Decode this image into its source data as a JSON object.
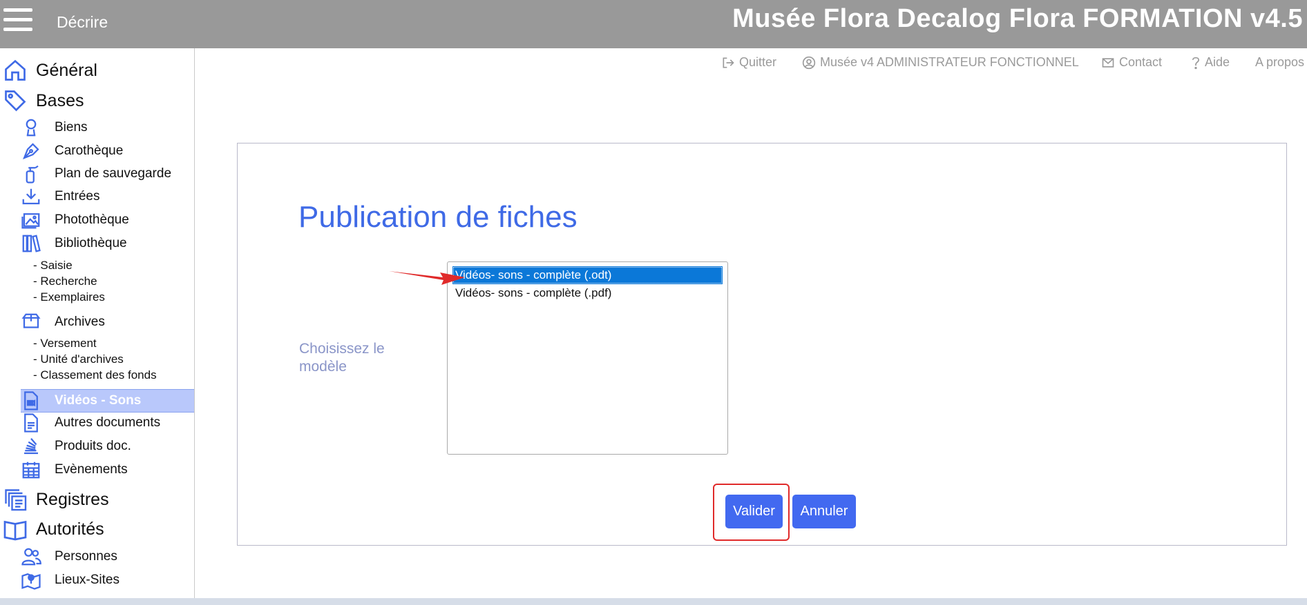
{
  "header": {
    "module": "Décrire",
    "title": "Musée Flora Decalog Flora FORMATION v4.5"
  },
  "toplinks": {
    "quit": "Quitter",
    "user": "Musée v4 ADMINISTRATEUR FONCTIONNEL",
    "contact": "Contact",
    "help": "Aide",
    "about": "A propos"
  },
  "sidebar": {
    "general": "Général",
    "bases": "Bases",
    "biens": "Biens",
    "carotheque": "Carothèque",
    "plan": "Plan de sauvegarde",
    "entrees": "Entrées",
    "phototheque": "Photothèque",
    "bibliotheque": "Bibliothèque",
    "biblio_subs": [
      "- Saisie",
      "- Recherche",
      "- Exemplaires"
    ],
    "archives": "Archives",
    "archives_subs": [
      "- Versement",
      "- Unité d'archives",
      "- Classement des fonds"
    ],
    "videos": "Vidéos - Sons",
    "autres": "Autres documents",
    "produits": "Produits doc.",
    "evenements": "Evènements",
    "registres": "Registres",
    "autorites": "Autorités",
    "personnes": "Personnes",
    "lieux": "Lieux-Sites"
  },
  "panel": {
    "title": "Publication de fiches",
    "label": "Choisissez le modèle",
    "options": [
      "Vidéos- sons - complète (.odt)",
      "Vidéos- sons - complète (.pdf)"
    ],
    "selected_index": 0,
    "validate": "Valider",
    "cancel": "Annuler"
  },
  "colors": {
    "topbar": "#999999",
    "accent": "#4269f0",
    "active_nav": "#b9c8fb",
    "selected_option": "#0b78d8",
    "annotation": "#e02a2a"
  }
}
